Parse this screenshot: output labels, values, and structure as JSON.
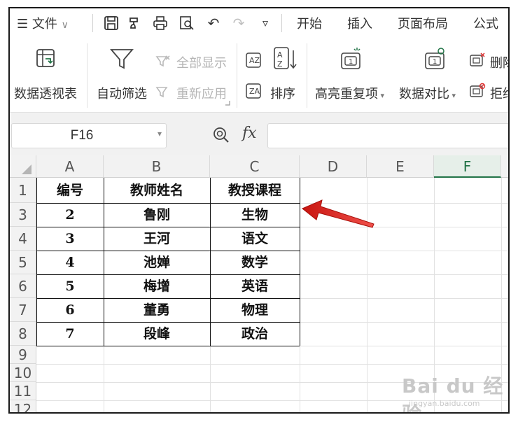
{
  "menu": {
    "items": [
      "文件",
      "开始",
      "插入",
      "页面布局",
      "公式"
    ]
  },
  "ribbon": {
    "pivot_label": "数据透视表",
    "autofilter_label": "自动筛选",
    "showall_label": "全部显示",
    "reapply_label": "重新应用",
    "sort_label": "排序",
    "highlight_dup_label": "高亮重复项",
    "compare_label": "数据对比",
    "delete_dup_label": "删除",
    "reject_dup_label": "拒绝"
  },
  "formula_bar": {
    "name_box": "F16",
    "fx": "fx",
    "formula": ""
  },
  "sheet": {
    "columns": [
      "A",
      "B",
      "C",
      "D",
      "E",
      "F"
    ],
    "active_column": "F",
    "row_numbers": [
      "1",
      "3",
      "4",
      "5",
      "6",
      "7",
      "8",
      "9",
      "10",
      "11",
      "12"
    ],
    "header": [
      "编号",
      "教师姓名",
      "教授课程"
    ],
    "rows": [
      [
        "2",
        "鲁刚",
        "生物"
      ],
      [
        "3",
        "王河",
        "语文"
      ],
      [
        "4",
        "池婵",
        "数学"
      ],
      [
        "5",
        "梅增",
        "英语"
      ],
      [
        "6",
        "董勇",
        "物理"
      ],
      [
        "7",
        "段峰",
        "政治"
      ]
    ]
  },
  "watermark": {
    "brand": "Bai du 经验",
    "url": "jingyan.baidu.com"
  },
  "colors": {
    "accent_green": "#217346",
    "arrow_red": "#e0241b"
  }
}
